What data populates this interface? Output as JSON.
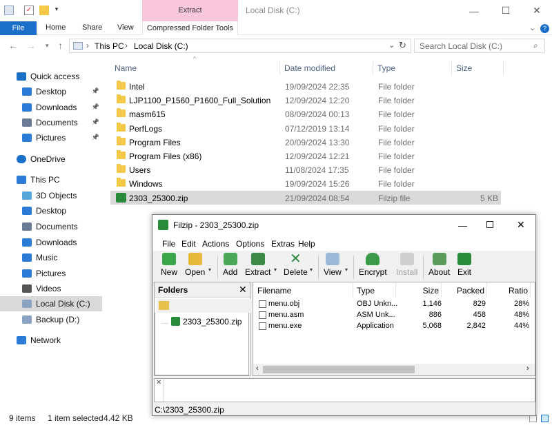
{
  "window": {
    "title": "Local Disk (C:)",
    "context_tab": "Extract",
    "minimize": "—",
    "maximize": "☐",
    "close": "✕"
  },
  "ribbon": {
    "tabs": [
      "File",
      "Home",
      "Share",
      "View",
      "Compressed Folder Tools"
    ],
    "help": "?"
  },
  "address": {
    "crumbs": [
      "This PC",
      "Local Disk (C:)"
    ],
    "search_placeholder": "Search Local Disk (C:)"
  },
  "nav": {
    "items": [
      {
        "label": "Quick access",
        "icon": "star-icon",
        "pinned": false,
        "indent": 0
      },
      {
        "label": "Desktop",
        "icon": "desktop-icon",
        "pinned": true,
        "indent": 1
      },
      {
        "label": "Downloads",
        "icon": "download-icon",
        "pinned": true,
        "indent": 1
      },
      {
        "label": "Documents",
        "icon": "documents-icon",
        "pinned": true,
        "indent": 1
      },
      {
        "label": "Pictures",
        "icon": "pictures-icon",
        "pinned": true,
        "indent": 1
      },
      {
        "label": "OneDrive",
        "icon": "cloud-icon",
        "pinned": false,
        "indent": 0
      },
      {
        "label": "This PC",
        "icon": "pc-icon",
        "pinned": false,
        "indent": 0
      },
      {
        "label": "3D Objects",
        "icon": "cube-icon",
        "pinned": false,
        "indent": 1
      },
      {
        "label": "Desktop",
        "icon": "desktop-icon",
        "pinned": false,
        "indent": 1
      },
      {
        "label": "Documents",
        "icon": "documents-icon",
        "pinned": false,
        "indent": 1
      },
      {
        "label": "Downloads",
        "icon": "download-icon",
        "pinned": false,
        "indent": 1
      },
      {
        "label": "Music",
        "icon": "music-icon",
        "pinned": false,
        "indent": 1
      },
      {
        "label": "Pictures",
        "icon": "pictures-icon",
        "pinned": false,
        "indent": 1
      },
      {
        "label": "Videos",
        "icon": "video-icon",
        "pinned": false,
        "indent": 1
      },
      {
        "label": "Local Disk (C:)",
        "icon": "drive-icon",
        "pinned": false,
        "indent": 1,
        "selected": true
      },
      {
        "label": "Backup (D:)",
        "icon": "drive-icon",
        "pinned": false,
        "indent": 1
      },
      {
        "label": "Network",
        "icon": "network-icon",
        "pinned": false,
        "indent": 0
      }
    ]
  },
  "list": {
    "headers": [
      "Name",
      "Date modified",
      "Type",
      "Size"
    ],
    "rows": [
      {
        "name": "Intel",
        "date": "19/09/2024 22:35",
        "type": "File folder",
        "size": ""
      },
      {
        "name": "LJP1100_P1560_P1600_Full_Solution",
        "date": "12/09/2024 12:20",
        "type": "File folder",
        "size": ""
      },
      {
        "name": "masm615",
        "date": "08/09/2024 00:13",
        "type": "File folder",
        "size": ""
      },
      {
        "name": "PerfLogs",
        "date": "07/12/2019 13:14",
        "type": "File folder",
        "size": ""
      },
      {
        "name": "Program Files",
        "date": "20/09/2024 13:30",
        "type": "File folder",
        "size": ""
      },
      {
        "name": "Program Files (x86)",
        "date": "12/09/2024 12:21",
        "type": "File folder",
        "size": ""
      },
      {
        "name": "Users",
        "date": "11/08/2024 17:35",
        "type": "File folder",
        "size": ""
      },
      {
        "name": "Windows",
        "date": "19/09/2024 15:26",
        "type": "File folder",
        "size": ""
      },
      {
        "name": "2303_25300.zip",
        "date": "21/09/2024 08:54",
        "type": "Filzip file",
        "size": "5 KB",
        "selected": true
      }
    ]
  },
  "status": {
    "count": "9 items",
    "selection": "1 item selected",
    "size": "4.42 KB"
  },
  "filzip": {
    "title": "Filzip - 2303_25300.zip",
    "menu": [
      "File",
      "Edit",
      "Actions",
      "Options",
      "Extras",
      "Help"
    ],
    "toolbar": [
      "New",
      "Open",
      "Add",
      "Extract",
      "Delete",
      "View",
      "Encrypt",
      "Install",
      "About",
      "Exit"
    ],
    "folders_header": "Folders",
    "tree_item": "2303_25300.zip",
    "columns": [
      "Filename",
      "Type",
      "Size",
      "Packed",
      "Ratio"
    ],
    "files": [
      {
        "name": "menu.obj",
        "type": "OBJ Unkn...",
        "size": "1,146",
        "packed": "829",
        "ratio": "28%"
      },
      {
        "name": "menu.asm",
        "type": "ASM Unk...",
        "size": "886",
        "packed": "458",
        "ratio": "48%"
      },
      {
        "name": "menu.exe",
        "type": "Application",
        "size": "5,068",
        "packed": "2,842",
        "ratio": "44%"
      }
    ],
    "status_path": "C:\\2303_25300.zip"
  },
  "colors": {
    "accent": "#1a6fc9",
    "context_tab": "#f9c7dc",
    "selection": "#d9d9d9",
    "folder": "#f4c848"
  }
}
